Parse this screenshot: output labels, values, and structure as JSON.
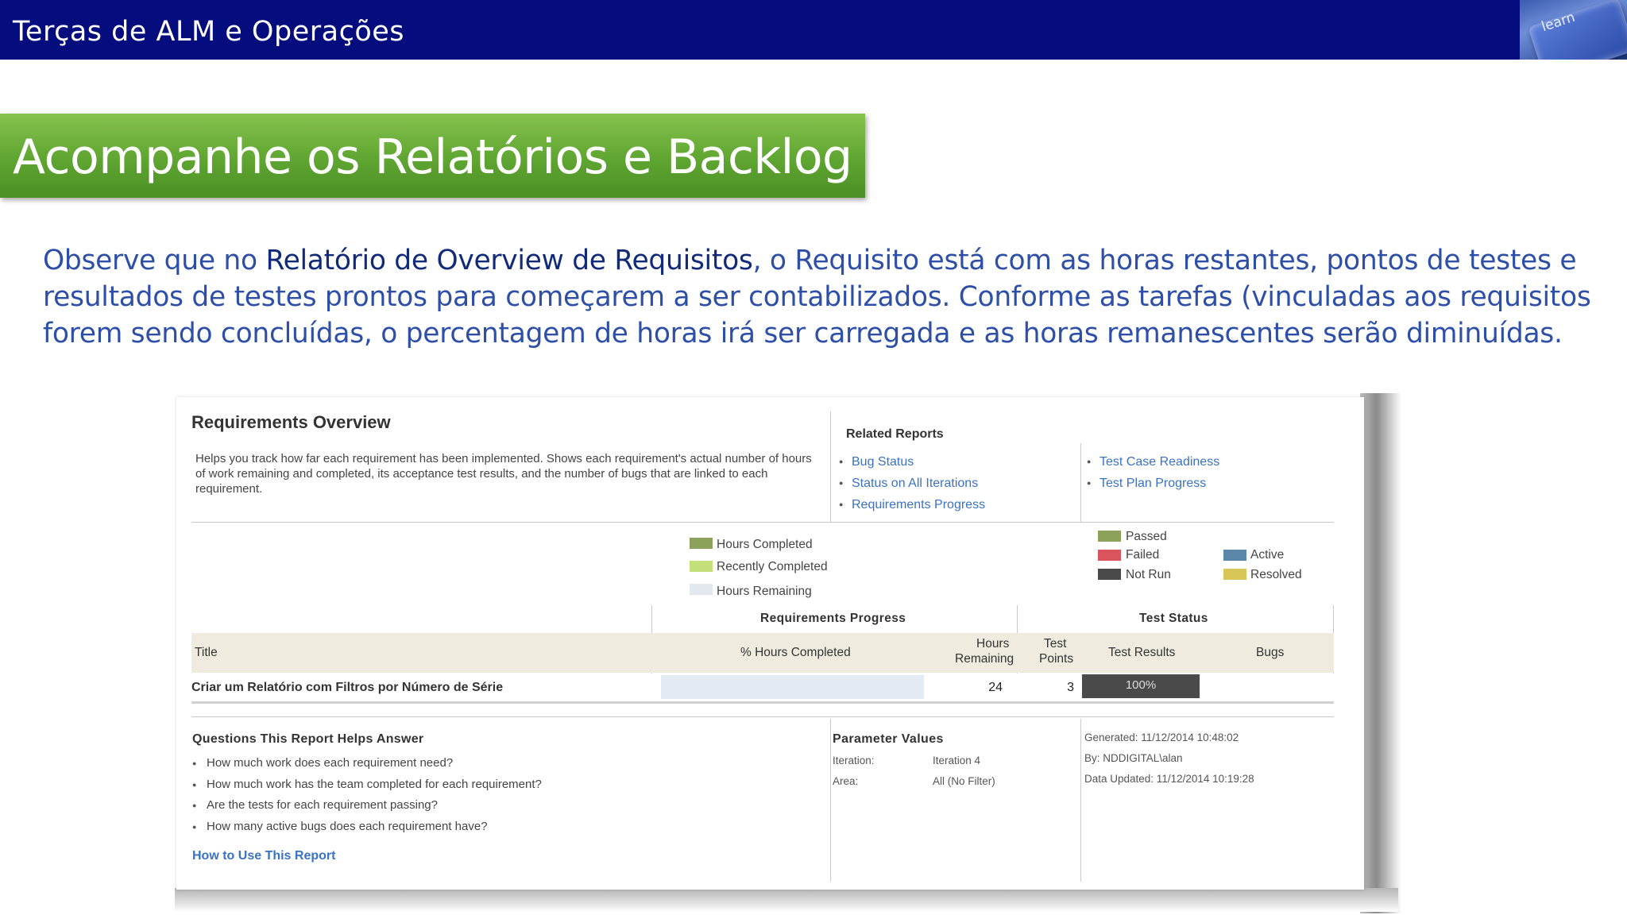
{
  "header": {
    "title": "Terças de ALM e Operações",
    "key_label": "learn"
  },
  "slide": {
    "heading": "Acompanhe os Relatórios e Backlog",
    "intro_before": "Observe que no ",
    "intro_highlight": "Relatório de Overview de Requisitos",
    "intro_after": ", o Requisito está com as horas restantes, pontos de testes e resultados de testes prontos para começarem a ser contabilizados. Conforme as tarefas (vinculadas aos requisitos forem sendo concluídas, o percentagem de horas irá ser carregada e as horas remanescentes serão diminuídas."
  },
  "report": {
    "title": "Requirements Overview",
    "description": "Helps you track how far each requirement has been implemented. Shows each requirement's actual number of hours of work remaining and completed, its acceptance test results, and the number of bugs that are linked to each requirement.",
    "related_reports": {
      "heading": "Related Reports",
      "left_links": [
        "Bug Status",
        "Status on All Iterations",
        "Requirements Progress"
      ],
      "right_links": [
        "Test Case Readiness",
        "Test Plan Progress"
      ]
    },
    "progress_legend": [
      {
        "label": "Hours Completed",
        "color": "#8ca25a"
      },
      {
        "label": "Recently Completed",
        "color": "#c3df7a"
      },
      {
        "label": "Hours Remaining",
        "color": "#e2e8ee"
      }
    ],
    "test_legend": [
      {
        "label": "Passed",
        "color": "#8ca25a"
      },
      {
        "label": "Failed",
        "color": "#d9545d"
      },
      {
        "label": "Not Run",
        "color": "#4a4a4a"
      },
      {
        "label": "Active",
        "color": "#5b87a9"
      },
      {
        "label": "Resolved",
        "color": "#d8c659"
      }
    ],
    "groups": {
      "progress": "Requirements Progress",
      "test": "Test Status"
    },
    "columns": {
      "title": "Title",
      "pct_hours": "% Hours Completed",
      "hours_remaining_1": "Hours",
      "hours_remaining_2": "Remaining",
      "test_points_1": "Test",
      "test_points_2": "Points",
      "test_results": "Test Results",
      "bugs": "Bugs"
    },
    "rows": [
      {
        "title": "Criar um Relatório com Filtros por Número de Série",
        "hours_completed_pct": 0,
        "hours_remaining": "24",
        "test_points": "3",
        "test_results": "100%",
        "bugs": ""
      }
    ],
    "questions": {
      "heading": "Questions This Report Helps Answer",
      "items": [
        "How much work does each requirement need?",
        "How much work has the team completed for each requirement?",
        "Are the tests for each requirement passing?",
        "How many active bugs does each requirement have?"
      ],
      "howto_link": "How to Use This Report"
    },
    "parameters": {
      "heading": "Parameter Values",
      "iteration_label": "Iteration:",
      "iteration_value": "Iteration 4",
      "area_label": "Area:",
      "area_value": "All (No Filter)"
    },
    "meta": {
      "generated": "Generated: 11/12/2014 10:48:02",
      "by": "By: NDDIGITAL\\alan",
      "data_updated": "Data Updated: 11/12/2014 10:19:28"
    }
  }
}
